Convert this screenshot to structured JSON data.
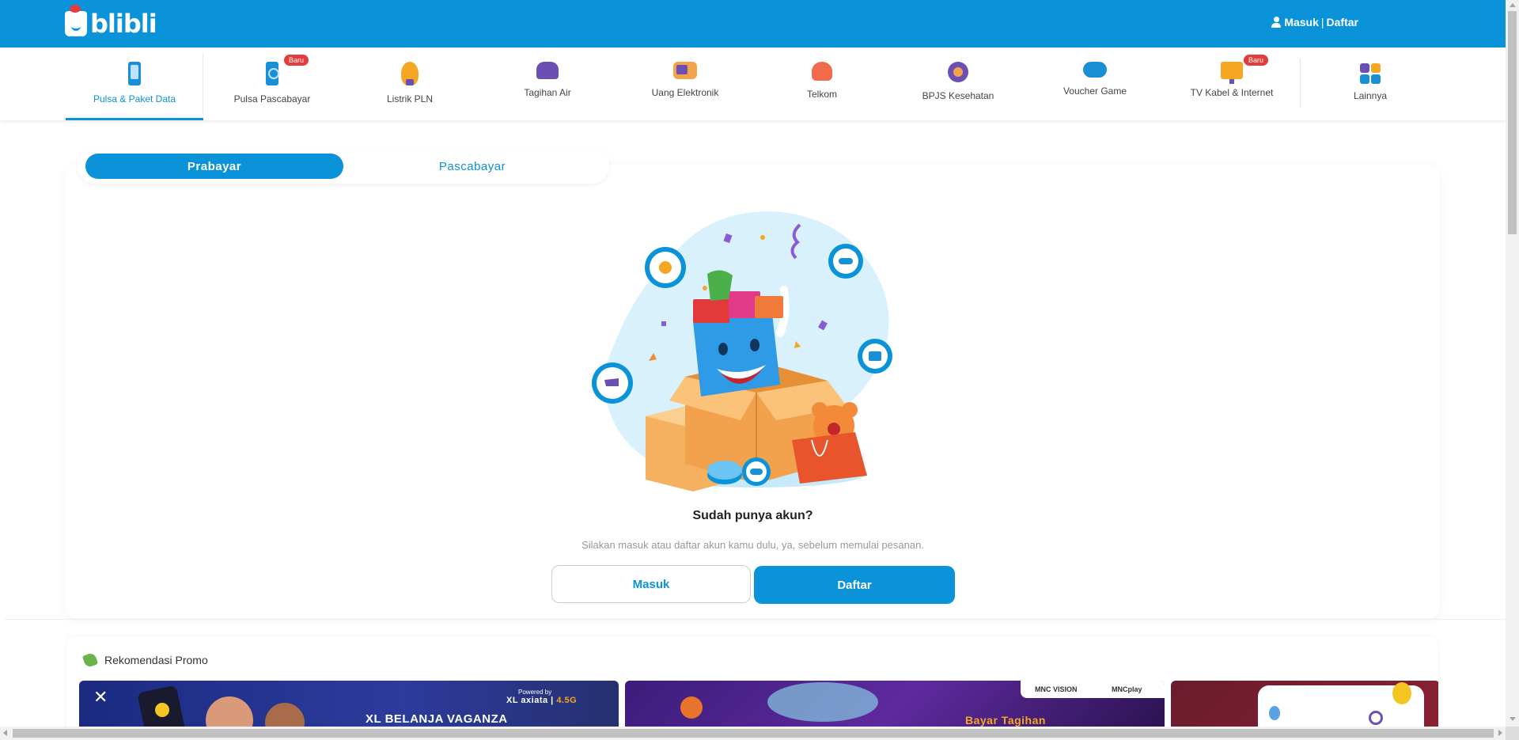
{
  "header": {
    "logo_text": "blibli",
    "login_label": "Masuk",
    "separator": "|",
    "register_label": "Daftar",
    "brand_color": "#0a93d8"
  },
  "categories": [
    {
      "label": "Pulsa & Paket Data",
      "icon": "phone-icon",
      "active": true
    },
    {
      "label": "Pulsa Pascabayar",
      "icon": "phone-postpaid-icon",
      "badge": "Baru"
    },
    {
      "label": "Listrik PLN",
      "icon": "lightbulb-icon"
    },
    {
      "label": "Tagihan Air",
      "icon": "water-tap-icon"
    },
    {
      "label": "Uang Elektronik",
      "icon": "wallet-icon"
    },
    {
      "label": "Telkom",
      "icon": "telephone-icon"
    },
    {
      "label": "BPJS Kesehatan",
      "icon": "health-icon"
    },
    {
      "label": "Voucher Game",
      "icon": "gamepad-icon"
    },
    {
      "label": "TV Kabel & Internet",
      "icon": "tv-icon",
      "badge": "Baru"
    },
    {
      "label": "Lainnya",
      "icon": "grid-icon"
    }
  ],
  "tabs": {
    "prepaid": "Prabayar",
    "postpaid": "Pascabayar"
  },
  "hero": {
    "title": "Sudah punya akun?",
    "description": "Silakan masuk atau daftar akun kamu dulu, ya, sebelum memulai pesanan.",
    "login_button": "Masuk",
    "register_button": "Daftar"
  },
  "promo": {
    "title": "Rekomendasi Promo",
    "banners": [
      {
        "name": "xl-banner",
        "headline": "XL BELANJA VAGANZA",
        "powered": "Powered by",
        "brand": "XL axiata",
        "tag": "4.5G"
      },
      {
        "name": "mnc-banner",
        "headline": "Bayar Tagihan",
        "brand1": "MNC VISION",
        "brand2": "MNCplay"
      },
      {
        "name": "third-banner"
      }
    ]
  }
}
